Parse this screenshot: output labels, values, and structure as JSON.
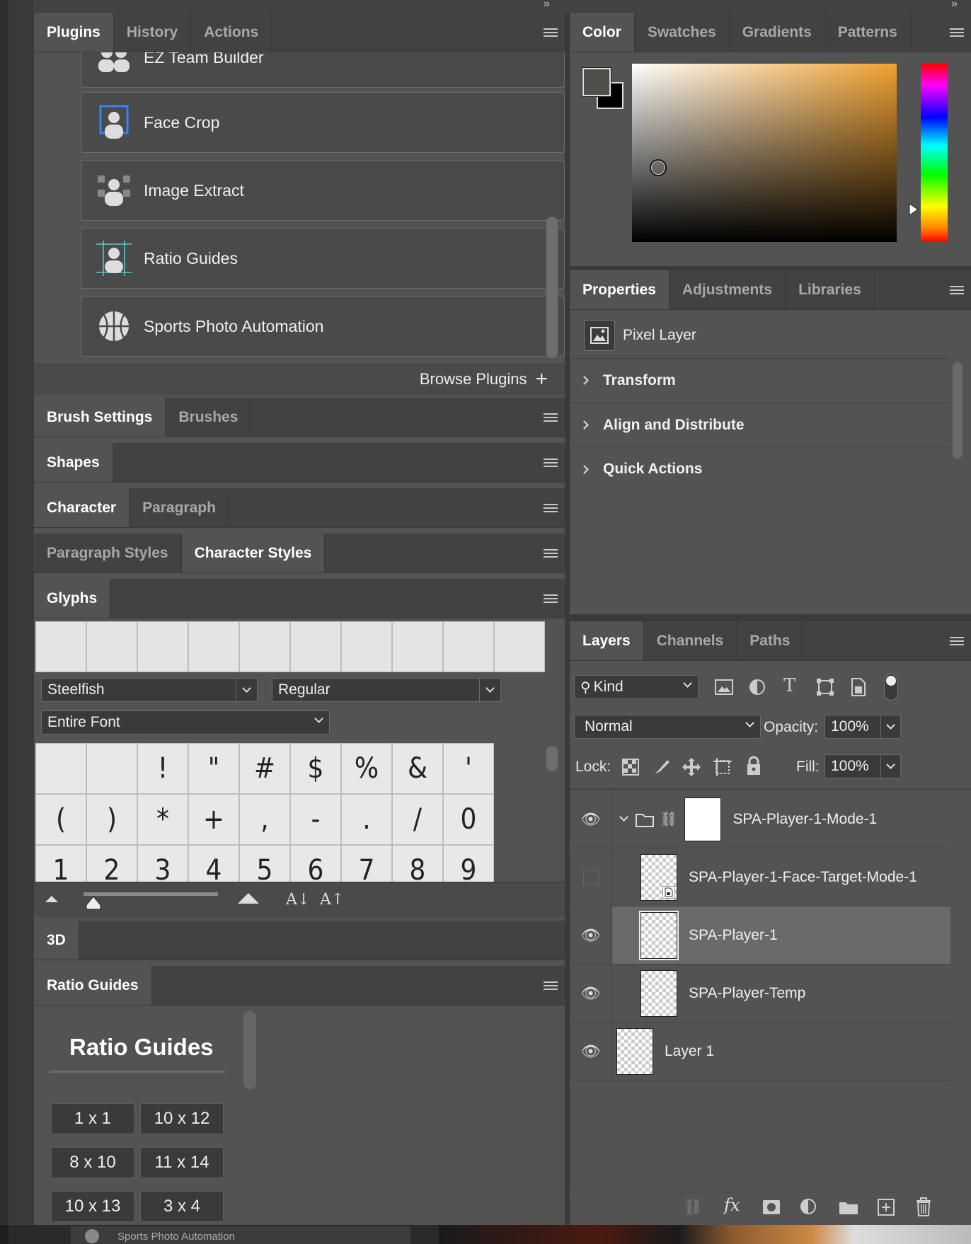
{
  "plugins_panel": {
    "tabs": [
      "Plugins",
      "History",
      "Actions"
    ],
    "items": [
      "EZ Team Builder",
      "Face Crop",
      "Image Extract",
      "Ratio Guides",
      "Sports Photo Automation"
    ],
    "browse_label": "Browse Plugins"
  },
  "brush_panel": {
    "tabs": [
      "Brush Settings",
      "Brushes"
    ]
  },
  "shapes_panel": {
    "tabs": [
      "Shapes"
    ]
  },
  "character_panel": {
    "tabs": [
      "Character",
      "Paragraph"
    ]
  },
  "styles_panel": {
    "tabs": [
      "Paragraph Styles",
      "Character Styles"
    ]
  },
  "glyphs_panel": {
    "tabs": [
      "Glyphs"
    ],
    "font": "Steelfish",
    "style": "Regular",
    "subset": "Entire Font",
    "row1": [
      "",
      "",
      "!",
      "\"",
      "#",
      "$",
      "%",
      "&",
      "'"
    ],
    "row2": [
      "(",
      ")",
      "*",
      "+",
      ",",
      "-",
      ".",
      "/",
      "0"
    ],
    "row3": [
      "1",
      "2",
      "3",
      "4",
      "5",
      "6",
      "7",
      "8",
      "9"
    ]
  },
  "panel_3d": {
    "tabs": [
      "3D"
    ]
  },
  "ratio_guides_panel": {
    "tabs": [
      "Ratio Guides"
    ],
    "heading": "Ratio Guides",
    "buttons": [
      "1 x 1",
      "10 x 12",
      "8 x 10",
      "11 x 14",
      "10 x 13",
      "3 x 4"
    ]
  },
  "color_panel": {
    "tabs": [
      "Color",
      "Swatches",
      "Gradients",
      "Patterns"
    ],
    "foreground": "#4f4f4b",
    "background": "#000000",
    "hue_color": "#f0a030"
  },
  "properties_panel": {
    "tabs": [
      "Properties",
      "Adjustments",
      "Libraries"
    ],
    "layer_type": "Pixel Layer",
    "sections": [
      "Transform",
      "Align and Distribute",
      "Quick Actions"
    ]
  },
  "layers_panel": {
    "tabs": [
      "Layers",
      "Channels",
      "Paths"
    ],
    "filter_kind": "Kind",
    "blend_mode": "Normal",
    "opacity_label": "Opacity:",
    "opacity": "100%",
    "lock_label": "Lock:",
    "fill_label": "Fill:",
    "fill": "100%",
    "layers": [
      {
        "name": "SPA-Player-1-Mode-1",
        "visible": true,
        "group": true
      },
      {
        "name": "SPA-Player-1-Face-Target-Mode-1",
        "visible": false
      },
      {
        "name": "SPA-Player-1",
        "visible": true,
        "selected": true
      },
      {
        "name": "SPA-Player-Temp",
        "visible": true
      },
      {
        "name": "Layer 1",
        "visible": true
      }
    ]
  },
  "bottom_strip": {
    "doc_tab": "Sports Photo Automation"
  }
}
